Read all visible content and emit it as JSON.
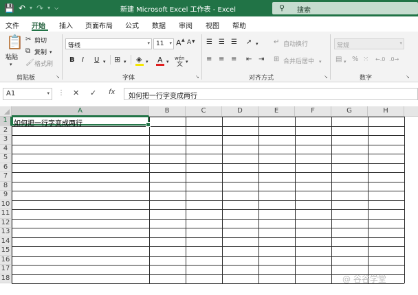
{
  "window": {
    "title": "新建 Microsoft Excel 工作表  -  Excel",
    "search_placeholder": "搜索"
  },
  "menu": {
    "tabs": [
      "文件",
      "开始",
      "插入",
      "页面布局",
      "公式",
      "数据",
      "审阅",
      "视图",
      "帮助"
    ],
    "active_tab": "开始"
  },
  "ribbon": {
    "clipboard": {
      "label": "剪贴板",
      "paste": "粘贴",
      "cut": "剪切",
      "copy": "复制",
      "format_painter": "格式刷"
    },
    "font": {
      "label": "字体",
      "font_name": "等线",
      "font_size": "11",
      "bold": "B",
      "italic": "I",
      "underline": "U",
      "grow": "A",
      "shrink": "A",
      "wen": "wén",
      "font_color_accent": "#e02020"
    },
    "alignment": {
      "label": "对齐方式",
      "wrap_text": "自动换行",
      "merge_center": "合并后居中"
    },
    "number": {
      "label": "数字",
      "format": "常规"
    }
  },
  "formula_bar": {
    "name_box": "A1",
    "cancel": "✕",
    "enter": "✓",
    "fx": "fx",
    "content": "如何把一行字变成两行"
  },
  "sheet": {
    "columns": [
      "A",
      "B",
      "C",
      "D",
      "E",
      "F",
      "G",
      "H"
    ],
    "rows": [
      "1",
      "2",
      "3",
      "4",
      "5",
      "6",
      "7",
      "8",
      "9",
      "10",
      "11",
      "12",
      "13",
      "14",
      "15",
      "16",
      "17",
      "18"
    ],
    "active_cell": "A1",
    "cell_a1": "如何把一行字变成两行"
  },
  "watermark": "@ 谷谷学堂",
  "colors": {
    "brand": "#217346",
    "grid_border": "#2b2b2b"
  }
}
